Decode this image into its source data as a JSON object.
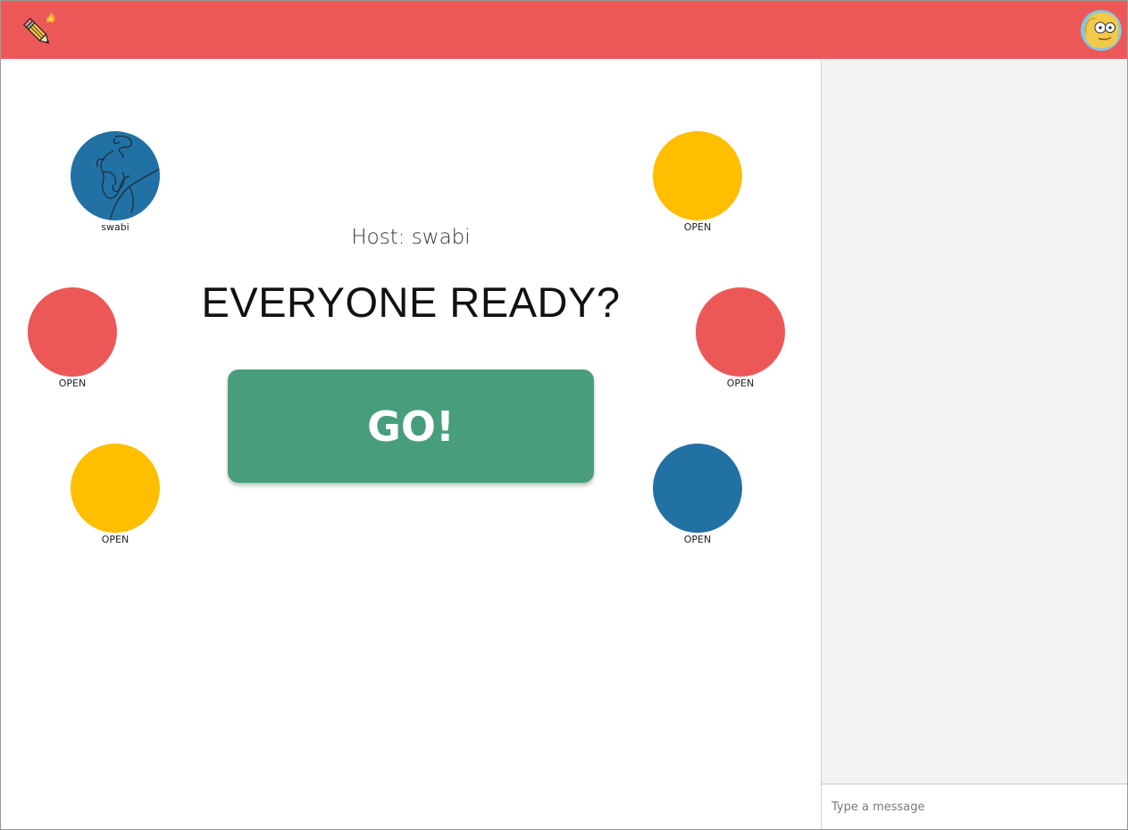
{
  "colors": {
    "header": "#ec5858",
    "blue": "#2271a5",
    "yellow": "#ffbe00",
    "red": "#ec5858",
    "green": "#489e7c",
    "chat_bg": "#f2f2f2"
  },
  "header": {
    "logo_icon": "pencil-icon",
    "avatar_icon": "user-avatar-cartoon"
  },
  "lobby": {
    "host_text": "Host: swabi",
    "ready_title": "EVERYONE READY?",
    "go_label": "GO!",
    "seats": [
      {
        "label": "swabi",
        "color": "#2271a5",
        "state": "occupied"
      },
      {
        "label": "OPEN",
        "color": "#ffbe00",
        "state": "open"
      },
      {
        "label": "OPEN",
        "color": "#ec5858",
        "state": "open"
      },
      {
        "label": "OPEN",
        "color": "#ec5858",
        "state": "open"
      },
      {
        "label": "OPEN",
        "color": "#ffbe00",
        "state": "open"
      },
      {
        "label": "OPEN",
        "color": "#2271a5",
        "state": "open"
      }
    ]
  },
  "chat": {
    "input_value": "",
    "input_placeholder": "Type a message"
  }
}
